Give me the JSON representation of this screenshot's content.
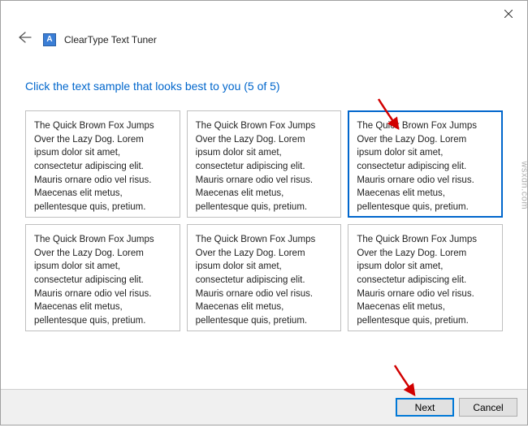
{
  "window": {
    "title": "ClearType Text Tuner"
  },
  "instruction": "Click the text sample that looks best to you (5 of 5)",
  "sample_text": "The Quick Brown Fox Jumps Over the Lazy Dog. Lorem ipsum dolor sit amet, consectetur adipiscing elit. Mauris ornare odio vel risus. Maecenas elit metus, pellentesque quis, pretium.",
  "samples": [
    {
      "selected": false
    },
    {
      "selected": false
    },
    {
      "selected": true
    },
    {
      "selected": false
    },
    {
      "selected": false
    },
    {
      "selected": false
    }
  ],
  "footer": {
    "next_label": "Next",
    "cancel_label": "Cancel"
  },
  "watermark": "wsxdn.com"
}
